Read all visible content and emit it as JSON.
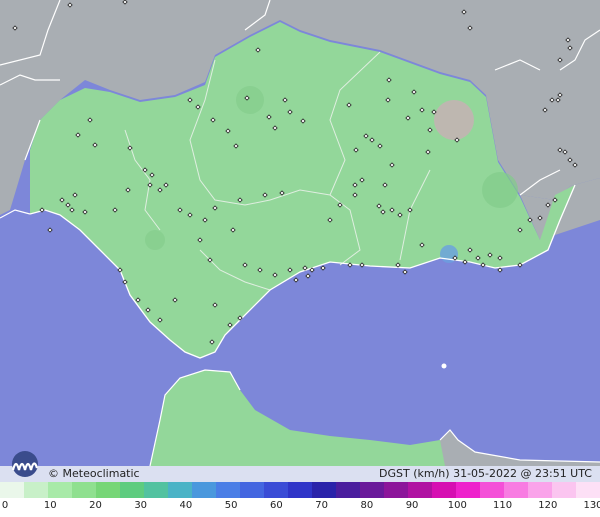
{
  "credit": {
    "brand": "© Meteoclimatic",
    "legend_text": "DGST (km/h)  31-05-2022 @ 23:51 UTC"
  },
  "scale": {
    "labels": [
      "0",
      "10",
      "20",
      "30",
      "40",
      "50",
      "60",
      "70",
      "80",
      "90",
      "100",
      "110",
      "120",
      "130"
    ],
    "colors": [
      "#eaf7ea",
      "#c8f0c8",
      "#a8eaa8",
      "#8fe08f",
      "#77d677",
      "#5ecc7f",
      "#52c2a0",
      "#4ab3c6",
      "#4a98dd",
      "#4a7ee6",
      "#4466e0",
      "#3a4cd6",
      "#2f35c8",
      "#2a23aa",
      "#4a1e9e",
      "#6a1a9a",
      "#8c159a",
      "#b012a2",
      "#d60fb2",
      "#ee22cc",
      "#f450d8",
      "#f87ce2",
      "#faa3ea",
      "#fbc5f0",
      "#fde0f6"
    ]
  },
  "colors": {
    "sea": "#7d87d9",
    "land_green": "#93d79a",
    "land_grey": "#a9aeb3",
    "border": "#ffffff"
  }
}
